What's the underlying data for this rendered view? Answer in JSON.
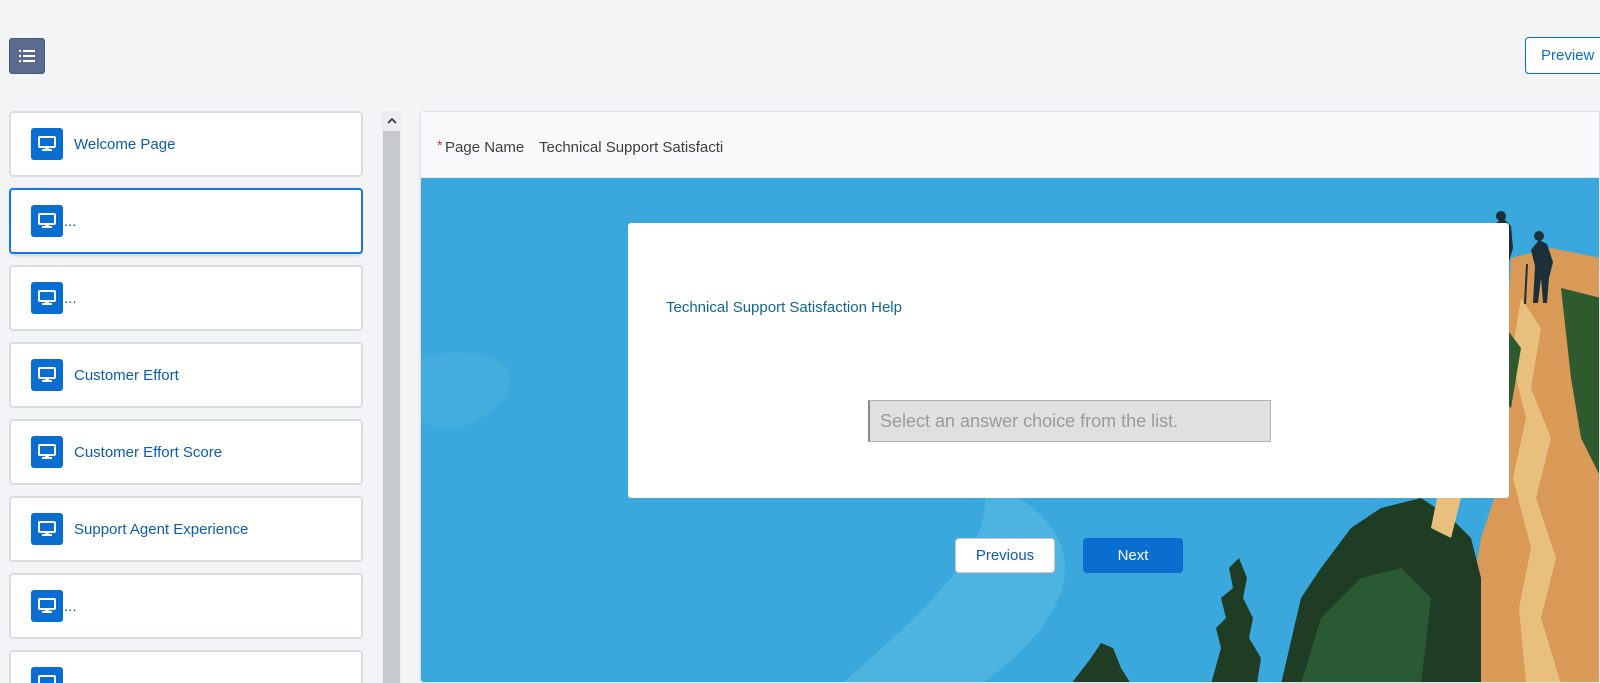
{
  "toolbar": {
    "toggle_icon": "list-icon",
    "preview_label": "Preview"
  },
  "sidebar": {
    "items": [
      {
        "label": "Welcome Page"
      },
      {
        "label": "..."
      },
      {
        "label": "..."
      },
      {
        "label": "Customer Effort"
      },
      {
        "label": "Customer Effort Score"
      },
      {
        "label": "Support Agent Experience"
      },
      {
        "label": "..."
      }
    ],
    "item_icon": "monitor-icon"
  },
  "editor": {
    "page_name_label": "Page Name",
    "page_name_value": "Technical Support Satisfacti",
    "question_title": "Technical Support Satisfaction Help",
    "answer_placeholder": "Select an answer choice from the list.",
    "previous_label": "Previous",
    "next_label": "Next"
  },
  "colors": {
    "accent": "#0a6ed1",
    "sky": "#3aa8dc",
    "required": "#c23934"
  }
}
